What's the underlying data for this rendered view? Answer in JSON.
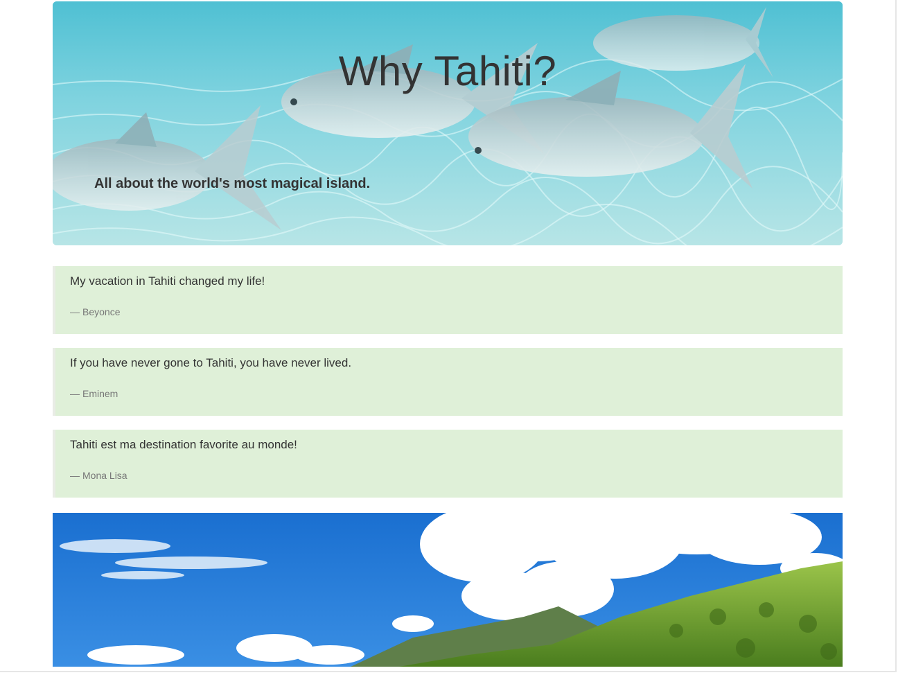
{
  "hero": {
    "title": "Why Tahiti?",
    "subtitle": "All about the world's most magical island."
  },
  "quotes": [
    {
      "text": "My vacation in Tahiti changed my life!",
      "author": "Beyonce"
    },
    {
      "text": "If you have never gone to Tahiti, you have never lived.",
      "author": "Eminem"
    },
    {
      "text": "Tahiti est ma destination favorite au monde!",
      "author": "Mona Lisa"
    }
  ],
  "quote_dash": "—",
  "colors": {
    "quote_background": "#dff0d8",
    "text": "#333333",
    "muted_text": "#777777"
  }
}
